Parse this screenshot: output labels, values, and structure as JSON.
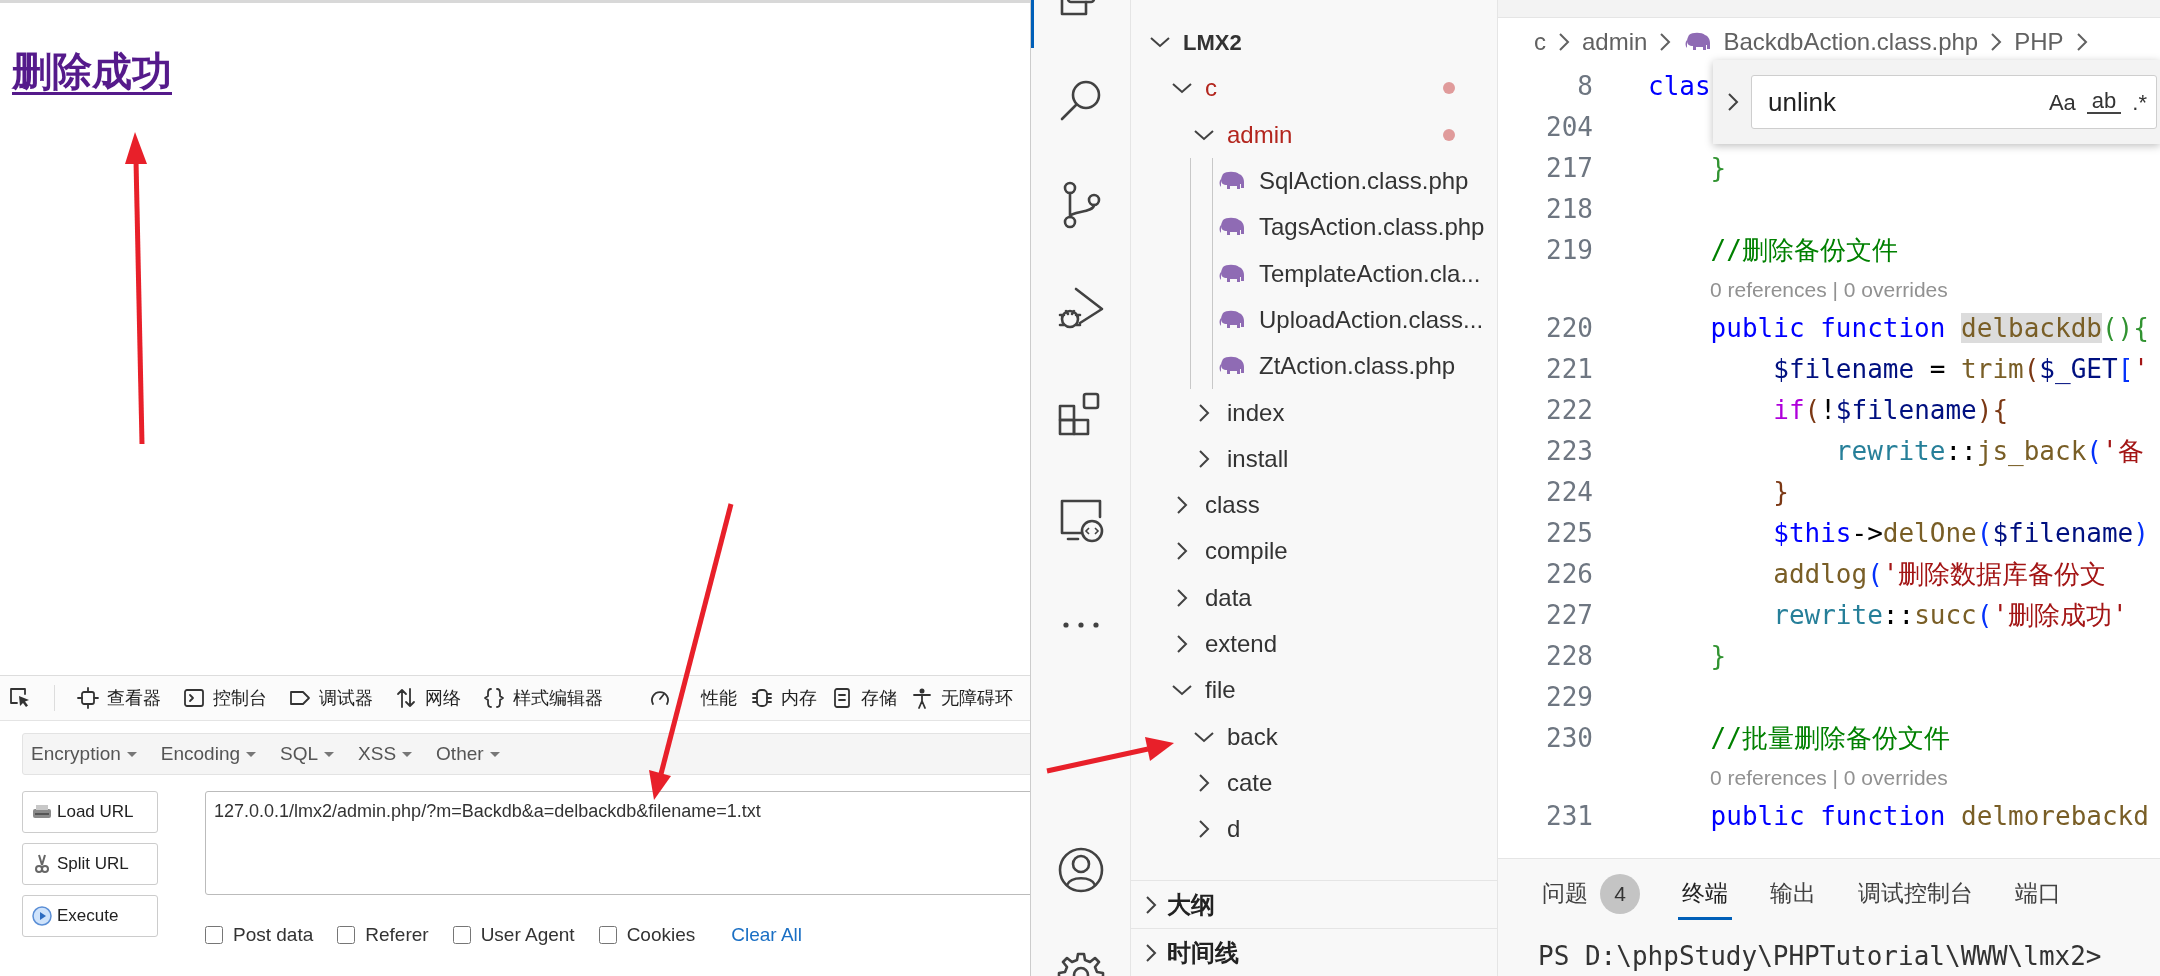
{
  "browser": {
    "page_link": "删除成功",
    "devtools_tabs": [
      {
        "label": "查看器",
        "kind": "inspector"
      },
      {
        "label": "控制台",
        "kind": "console"
      },
      {
        "label": "调试器",
        "kind": "debugger"
      },
      {
        "label": "网络",
        "kind": "network"
      },
      {
        "label": "样式编辑器",
        "kind": "style"
      },
      {
        "label": "性能",
        "kind": "performance"
      },
      {
        "label": "内存",
        "kind": "memory"
      },
      {
        "label": "存储",
        "kind": "storage"
      },
      {
        "label": "无障碍环",
        "kind": "accessibility"
      }
    ],
    "hackbar": {
      "menus": [
        "Encryption",
        "Encoding",
        "SQL",
        "XSS",
        "Other"
      ],
      "buttons": [
        {
          "label": "Load URL",
          "kind": "load"
        },
        {
          "label": "Split URL",
          "kind": "split"
        },
        {
          "label": "Execute",
          "kind": "execute"
        }
      ],
      "url": "127.0.0.1/lmx2/admin.php/?m=Backdb&a=delbackdb&filename=1.txt",
      "options": [
        {
          "label": "Post data",
          "checked": false
        },
        {
          "label": "Referer",
          "checked": false
        },
        {
          "label": "User Agent",
          "checked": false
        },
        {
          "label": "Cookies",
          "checked": false
        }
      ],
      "clear": "Clear All"
    }
  },
  "explorer": {
    "tree": {
      "label": "LMX2",
      "kind": "root",
      "expanded": true,
      "children": [
        {
          "label": "c",
          "kind": "folder",
          "expanded": true,
          "modified": true,
          "children": [
            {
              "label": "admin",
              "kind": "folder",
              "expanded": true,
              "modified": true,
              "children": [
                {
                  "label": "SqlAction.class.php",
                  "kind": "php"
                },
                {
                  "label": "TagsAction.class.php",
                  "kind": "php"
                },
                {
                  "label": "TemplateAction.cla...",
                  "kind": "php"
                },
                {
                  "label": "UploadAction.class...",
                  "kind": "php"
                },
                {
                  "label": "ZtAction.class.php",
                  "kind": "php"
                }
              ]
            },
            {
              "label": "index",
              "kind": "folder",
              "expanded": false,
              "modified": false
            },
            {
              "label": "install",
              "kind": "folder",
              "expanded": false,
              "modified": false
            }
          ]
        },
        {
          "label": "class",
          "kind": "folder",
          "expanded": false,
          "modified": false
        },
        {
          "label": "compile",
          "kind": "folder",
          "expanded": false,
          "modified": false
        },
        {
          "label": "data",
          "kind": "folder",
          "expanded": false,
          "modified": false
        },
        {
          "label": "extend",
          "kind": "folder",
          "expanded": false,
          "modified": false
        },
        {
          "label": "file",
          "kind": "folder",
          "expanded": true,
          "modified": false,
          "children": [
            {
              "label": "back",
              "kind": "folder",
              "expanded": true,
              "modified": false
            },
            {
              "label": "cate",
              "kind": "folder",
              "expanded": false,
              "modified": false
            },
            {
              "label": "d",
              "kind": "folder",
              "expanded": false,
              "modified": false
            }
          ]
        }
      ]
    },
    "sections": [
      {
        "label": "大纲",
        "expanded": false
      },
      {
        "label": "时间线",
        "expanded": false
      }
    ]
  },
  "editor": {
    "breadcrumb": [
      {
        "label": "c",
        "kind": "folder"
      },
      {
        "label": "admin",
        "kind": "folder"
      },
      {
        "label": "BackdbAction.class.php",
        "kind": "php"
      },
      {
        "label": "PHP",
        "kind": "symbol"
      }
    ],
    "find": {
      "value": "unlink",
      "options": [
        "Aa",
        "ab",
        ".*"
      ]
    },
    "lines": [
      {
        "kind": "code",
        "number": "8",
        "tokens": [
          {
            "text": "clas",
            "kind": "kw"
          }
        ]
      },
      {
        "kind": "code",
        "number": "204"
      },
      {
        "kind": "code",
        "number": "217",
        "tokens": [
          {
            "text": "    }",
            "kind": "b1"
          }
        ]
      },
      {
        "kind": "code",
        "number": "218"
      },
      {
        "kind": "code",
        "number": "219",
        "tokens": [
          {
            "text": "    //删除备份文件",
            "kind": "cmt"
          }
        ]
      },
      {
        "kind": "lens",
        "text": "0 references | 0 overrides"
      },
      {
        "kind": "code",
        "number": "220",
        "tokens": [
          {
            "text": "    public function ",
            "kind": "kw"
          },
          {
            "text": "delbackdb",
            "kind": "fnhl"
          },
          {
            "text": "(){",
            "kind": "b1"
          }
        ]
      },
      {
        "kind": "code",
        "number": "221",
        "tokens": [
          {
            "text": "        $filename",
            "kind": "var"
          },
          {
            "text": " = ",
            "kind": "op"
          },
          {
            "text": "trim",
            "kind": "fn"
          },
          {
            "text": "(",
            "kind": "b2"
          },
          {
            "text": "$_GET",
            "kind": "var"
          },
          {
            "text": "[",
            "kind": "b3"
          },
          {
            "text": "'",
            "kind": "str"
          }
        ]
      },
      {
        "kind": "code",
        "number": "222",
        "tokens": [
          {
            "text": "        if",
            "kind": "ctl"
          },
          {
            "text": "(",
            "kind": "b2"
          },
          {
            "text": "!",
            "kind": "op"
          },
          {
            "text": "$filename",
            "kind": "var"
          },
          {
            "text": "){",
            "kind": "b2"
          }
        ]
      },
      {
        "kind": "code",
        "number": "223",
        "tokens": [
          {
            "text": "            rewrite",
            "kind": "cls"
          },
          {
            "text": "::",
            "kind": "op"
          },
          {
            "text": "js_back",
            "kind": "fn"
          },
          {
            "text": "(",
            "kind": "b3"
          },
          {
            "text": "'备",
            "kind": "str"
          }
        ]
      },
      {
        "kind": "code",
        "number": "224",
        "tokens": [
          {
            "text": "        }",
            "kind": "b2"
          }
        ]
      },
      {
        "kind": "code",
        "number": "225",
        "tokens": [
          {
            "text": "        $this",
            "kind": "kw"
          },
          {
            "text": "->",
            "kind": "op"
          },
          {
            "text": "delOne",
            "kind": "fn"
          },
          {
            "text": "(",
            "kind": "b3"
          },
          {
            "text": "$filename",
            "kind": "var"
          },
          {
            "text": ")",
            "kind": "b3"
          }
        ]
      },
      {
        "kind": "code",
        "number": "226",
        "tokens": [
          {
            "text": "        addlog",
            "kind": "fn"
          },
          {
            "text": "(",
            "kind": "b3"
          },
          {
            "text": "'删除数据库备份文",
            "kind": "str"
          }
        ]
      },
      {
        "kind": "code",
        "number": "227",
        "tokens": [
          {
            "text": "        rewrite",
            "kind": "cls"
          },
          {
            "text": "::",
            "kind": "op"
          },
          {
            "text": "succ",
            "kind": "fn"
          },
          {
            "text": "(",
            "kind": "b3"
          },
          {
            "text": "'删除成功'",
            "kind": "str"
          }
        ]
      },
      {
        "kind": "code",
        "number": "228",
        "tokens": [
          {
            "text": "    }",
            "kind": "b1"
          }
        ]
      },
      {
        "kind": "code",
        "number": "229"
      },
      {
        "kind": "code",
        "number": "230",
        "tokens": [
          {
            "text": "    //批量删除备份文件",
            "kind": "cmt"
          }
        ]
      },
      {
        "kind": "lens",
        "text": "0 references | 0 overrides"
      },
      {
        "kind": "code",
        "number": "231",
        "tokens": [
          {
            "text": "    public function ",
            "kind": "kw"
          },
          {
            "text": "delmorebackd",
            "kind": "fn"
          }
        ]
      }
    ]
  },
  "panel": {
    "tabs": [
      {
        "label": "问题",
        "badge": "4",
        "selected": false
      },
      {
        "label": "终端",
        "selected": true
      },
      {
        "label": "输出",
        "selected": false
      },
      {
        "label": "调试控制台",
        "selected": false
      },
      {
        "label": "端口",
        "selected": false
      }
    ],
    "terminal": "PS D:\\phpStudy\\PHPTutorial\\WWW\\lmx2>"
  }
}
